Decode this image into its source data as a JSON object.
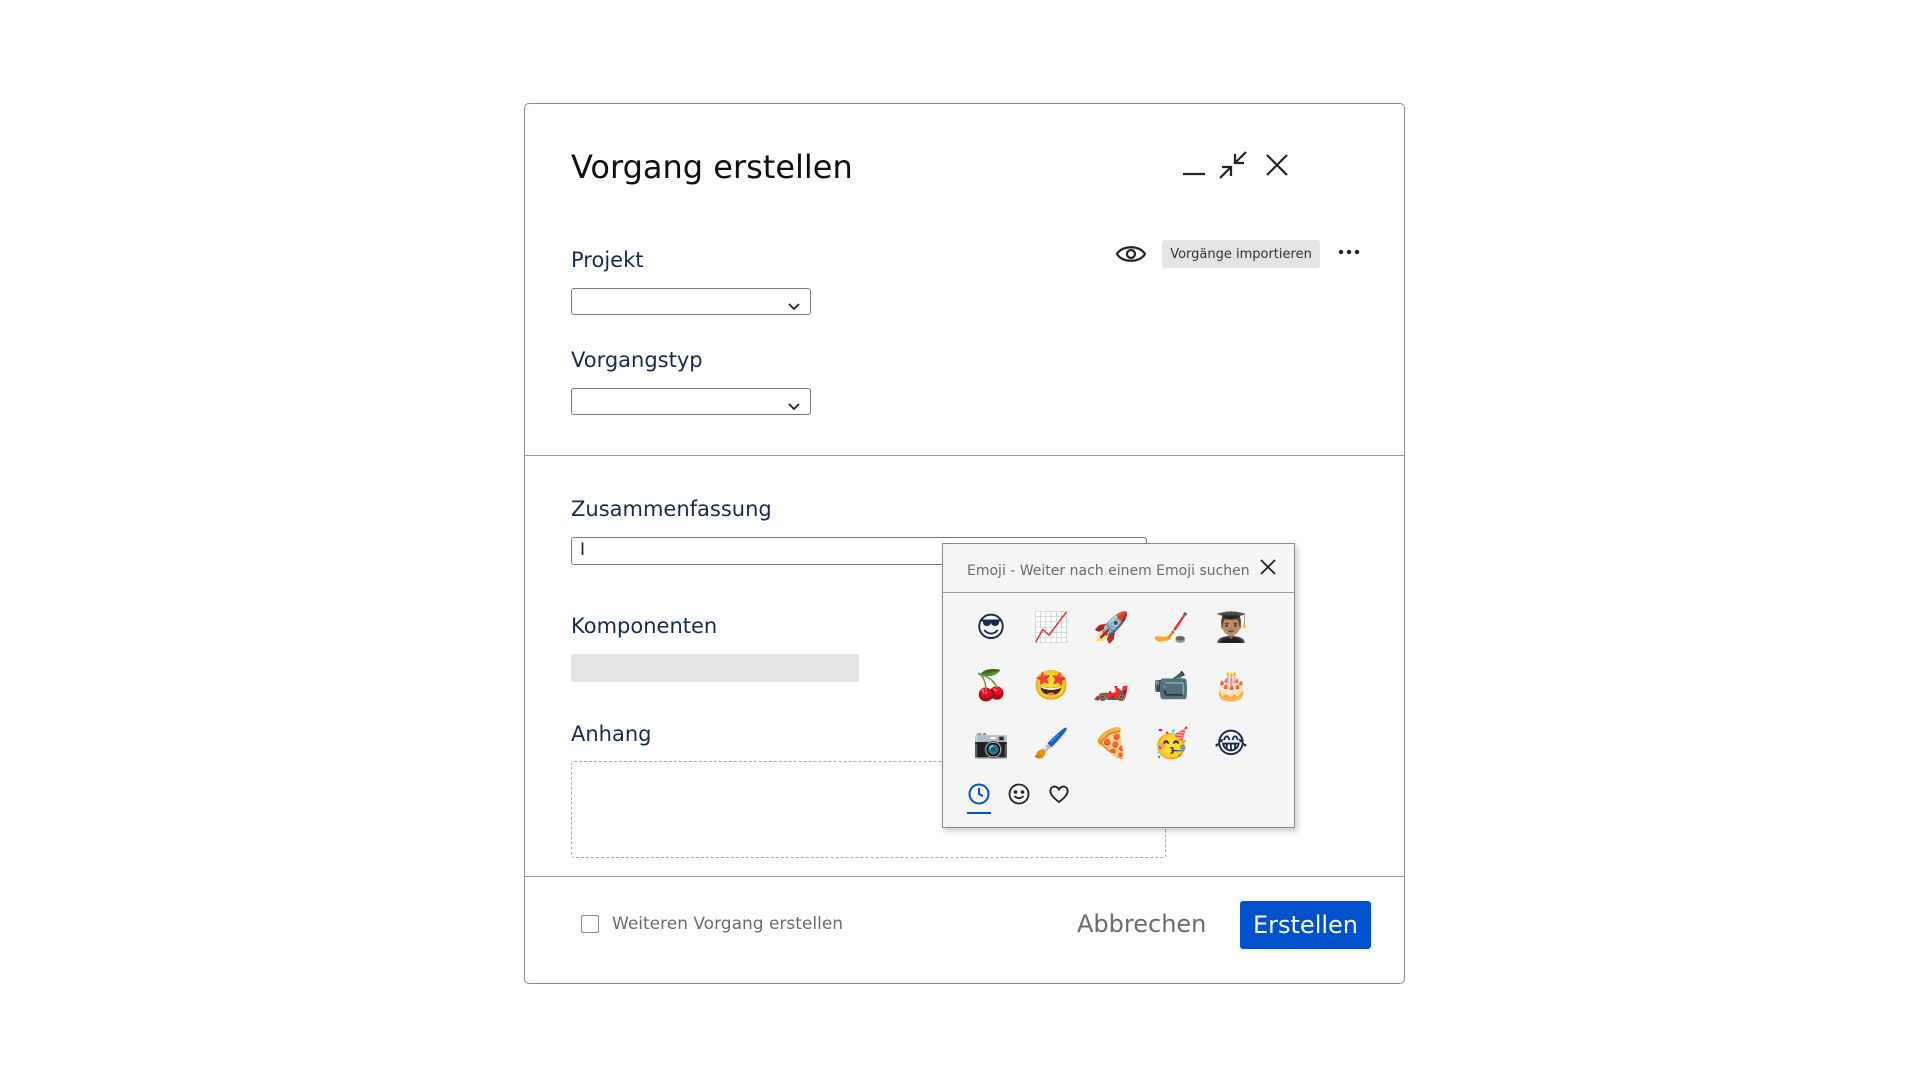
{
  "dialog": {
    "title": "Vorgang erstellen",
    "controls": {
      "minimize_icon": "minimize-icon",
      "collapse_icon": "collapse-icon",
      "close_icon": "close-icon"
    }
  },
  "toolbar": {
    "watch_icon": "eye-icon",
    "import_label": "Vorgänge importieren",
    "more_icon": "more-icon"
  },
  "fields": {
    "projekt_label": "Projekt",
    "projekt_value": "",
    "vorgangstyp_label": "Vorgangstyp",
    "vorgangstyp_value": "",
    "zusammenfassung_label": "Zusammenfassung",
    "zusammenfassung_value": "I",
    "komponenten_label": "Komponenten",
    "anhang_label": "Anhang"
  },
  "emoji_picker": {
    "search_placeholder": "Emoji - Weiter nach einem Emoji suchen",
    "emojis": [
      "😎",
      "📈",
      "🚀",
      "🏒",
      "👨🏽‍🎓",
      "🍒",
      "🤩",
      "🏎️",
      "📹",
      "🎂",
      "📷",
      "🖌️",
      "🍕",
      "🥳",
      "😂"
    ],
    "tabs": [
      "recent-icon",
      "smiley-icon",
      "heart-icon"
    ],
    "active_tab": "recent-icon"
  },
  "footer": {
    "checkbox_label": "Weiteren Vorgang erstellen",
    "checkbox_checked": false,
    "cancel_label": "Abbrechen",
    "create_label": "Erstellen"
  },
  "colors": {
    "primary": "#0052cc",
    "field_grey": "#e4e4e4"
  }
}
